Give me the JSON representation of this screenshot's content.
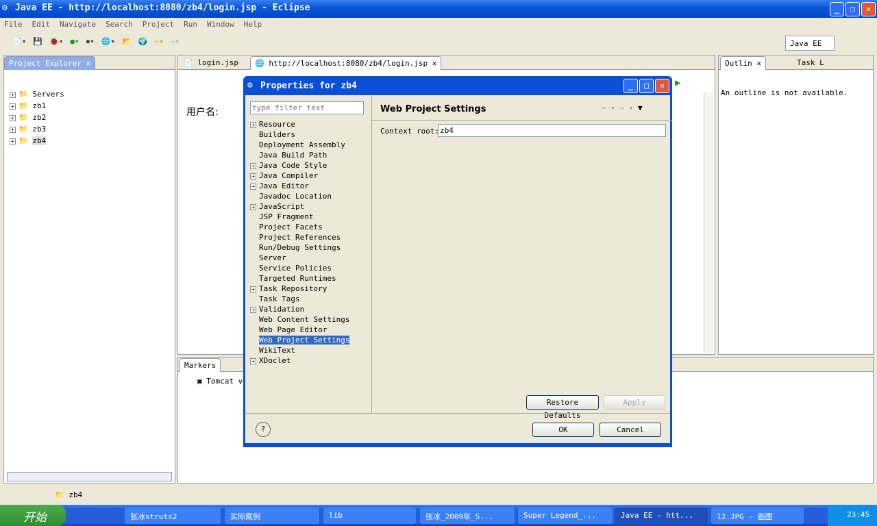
{
  "window": {
    "title": "Java EE - http://localhost:8080/zb4/login.jsp - Eclipse"
  },
  "menu": [
    "File",
    "Edit",
    "Navigate",
    "Search",
    "Project",
    "Run",
    "Window",
    "Help"
  ],
  "perspective": "Java EE",
  "explorer": {
    "title": "Project Explorer",
    "items": [
      "Servers",
      "zb1",
      "zb2",
      "zb3",
      "zb4"
    ]
  },
  "editor": {
    "tabs": [
      "login.jsp",
      "http://localhost:8080/zb4/login.jsp"
    ],
    "content_label": "用户名:"
  },
  "outline": {
    "tabs": [
      "Outlin",
      "Task L"
    ],
    "message": "An outline is not available."
  },
  "bottom": {
    "tabs": [
      "Markers"
    ],
    "server": "Tomcat v6"
  },
  "status": {
    "selected": "zb4"
  },
  "dialog": {
    "title": "Properties for zb4",
    "filter_placeholder": "type filter text",
    "tree": [
      {
        "label": "Resource",
        "expand": true
      },
      {
        "label": "Builders"
      },
      {
        "label": "Deployment Assembly"
      },
      {
        "label": "Java Build Path"
      },
      {
        "label": "Java Code Style",
        "expand": true
      },
      {
        "label": "Java Compiler",
        "expand": true
      },
      {
        "label": "Java Editor",
        "expand": true
      },
      {
        "label": "Javadoc Location"
      },
      {
        "label": "JavaScript",
        "expand": true
      },
      {
        "label": "JSP Fragment"
      },
      {
        "label": "Project Facets"
      },
      {
        "label": "Project References"
      },
      {
        "label": "Run/Debug Settings"
      },
      {
        "label": "Server"
      },
      {
        "label": "Service Policies"
      },
      {
        "label": "Targeted Runtimes"
      },
      {
        "label": "Task Repository",
        "expand": true
      },
      {
        "label": "Task Tags"
      },
      {
        "label": "Validation",
        "expand": true
      },
      {
        "label": "Web Content Settings"
      },
      {
        "label": "Web Page Editor"
      },
      {
        "label": "Web Project Settings",
        "selected": true
      },
      {
        "label": "WikiText"
      },
      {
        "label": "XDoclet",
        "expand": true
      }
    ],
    "page_title": "Web Project Settings",
    "context_root_label": "Context root:",
    "context_root": "zb4",
    "restore": "Restore Defaults",
    "apply": "Apply",
    "ok": "OK",
    "cancel": "Cancel"
  },
  "taskbar": {
    "start": "开始",
    "tasks": [
      "张冰struts2",
      "实际案例",
      "lib",
      "张冰_2009年_S...",
      "Super Legend_...",
      "Java EE - htt...",
      "12.JPG - 画图"
    ],
    "clock": "23:45"
  }
}
